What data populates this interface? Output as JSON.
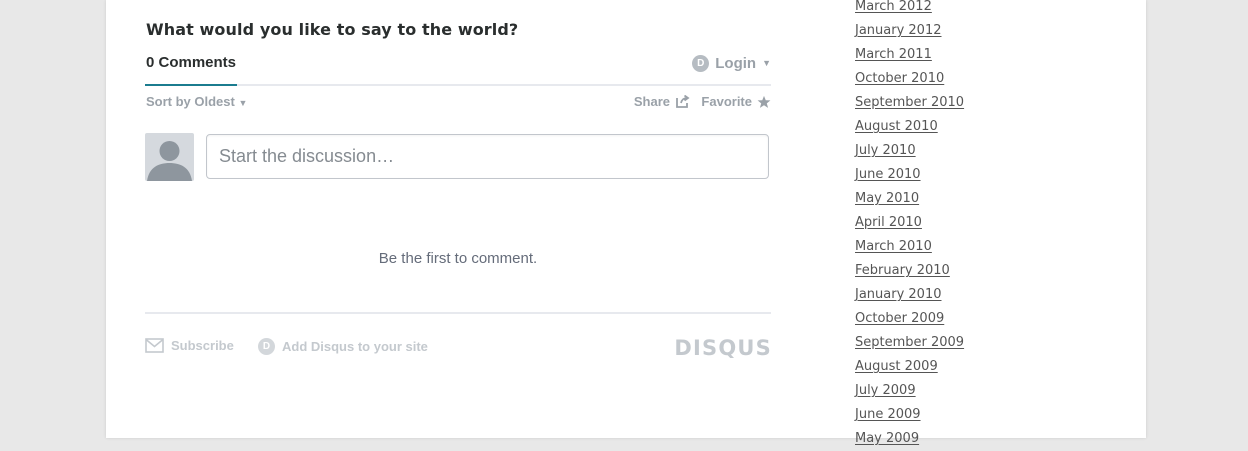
{
  "discussion": {
    "heading": "What would you like to say to the world?",
    "comments_tab": "0 Comments",
    "login_badge": "D",
    "login_label": "Login",
    "sort_label": "Sort by Oldest",
    "share_label": "Share",
    "favorite_label": "Favorite",
    "compose_placeholder": "Start the discussion…",
    "empty_message": "Be the first to comment.",
    "subscribe_label": "Subscribe",
    "add_disqus_badge": "D",
    "add_disqus_label": "Add Disqus to your site",
    "brand": "DISQUS"
  },
  "archive": [
    "March 2012",
    "January 2012",
    "March 2011",
    "October 2010",
    "September 2010",
    "August 2010",
    "July 2010",
    "June 2010",
    "May 2010",
    "April 2010",
    "March 2010",
    "February 2010",
    "January 2010",
    "October 2009",
    "September 2009",
    "August 2009",
    "July 2009",
    "June 2009",
    "May 2009"
  ],
  "colors": {
    "background": "#e8e8e8",
    "active_tab_underline": "#1b7c8f",
    "muted_text": "#9aa1a8"
  },
  "icons": [
    "login-badge-icon",
    "caret-down-icon",
    "share-icon",
    "star-icon",
    "avatar-icon",
    "envelope-icon",
    "disqus-badge-icon"
  ]
}
